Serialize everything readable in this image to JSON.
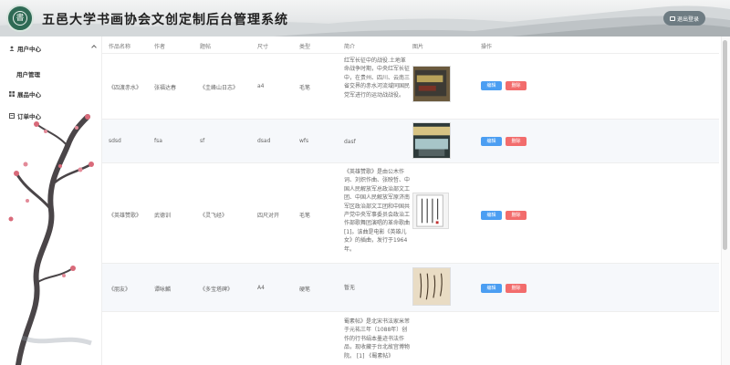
{
  "header": {
    "title": "五邑大学书画协会文创定制后台管理系统",
    "logo_text": "書",
    "logout_label": "退出登录"
  },
  "sidebar": {
    "items": [
      {
        "label": "用户中心",
        "icon": "user-icon"
      },
      {
        "label": "用户管理"
      },
      {
        "label": "展品中心",
        "icon": "grid-icon"
      },
      {
        "label": "订单中心",
        "icon": "order-icon"
      }
    ]
  },
  "table": {
    "headers": [
      "作品名称",
      "作者",
      "题帖",
      "尺寸",
      "类型",
      "简介",
      "图片",
      "操作"
    ],
    "rows": [
      {
        "name": "《四渡赤水》",
        "author": "张福达春",
        "subject": "《圭峰山日志》",
        "size": "a4",
        "type": "毛笔",
        "intro": "红军长征中的战役.土地革命战争时期，中央红军长征中，在贵州、四川、云南三省交界的赤水河流域同国民党军进行的运动战战役。"
      },
      {
        "name": "sdsd",
        "author": "fsa",
        "subject": "sf",
        "size": "dsad",
        "type": "wfs",
        "intro": "dasf"
      },
      {
        "name": "《英雄赞歌》",
        "author": "武德训",
        "subject": "《灵飞经》",
        "size": "四尺对开",
        "type": "毛笔",
        "intro": "《英雄赞歌》是由公木作词、刘炽作曲、张映哲、中国人民解放军总政治部文工团、中国人民解放军原济南军区政治部文工团和中国共产党中央军事委员会政治工作部歌舞团演唱的革命歌曲 [1]。该曲是电影《英雄儿女》的插曲，发行于1964年。"
      },
      {
        "name": "《朋友》",
        "author": "谭咏麟",
        "subject": "《多宝塔碑》",
        "size": "A4",
        "type": "硬笔",
        "intro": "暂无"
      },
      {
        "name": "",
        "author": "",
        "subject": "",
        "size": "",
        "type": "",
        "intro": "蜀素帖》是北宋书法家米芾于元祐三年（1088年）创作的行书绢本墨迹书法作品，现收藏于台北故宫博物院。 [1] 《蜀素帖》"
      }
    ],
    "edit_label": "编辑",
    "delete_label": "删除"
  }
}
